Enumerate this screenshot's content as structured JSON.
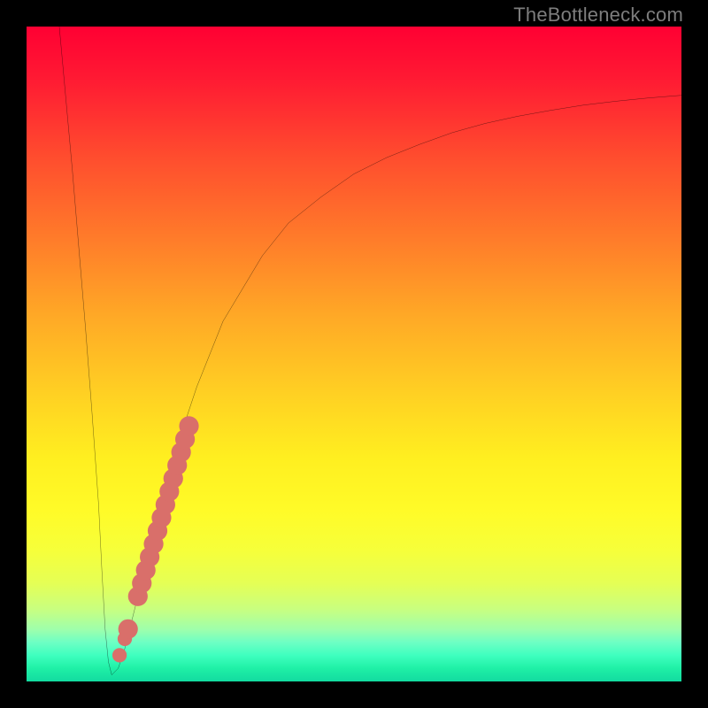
{
  "watermark": "TheBottleneck.com",
  "colors": {
    "frame": "#000000",
    "curve_stroke": "#000000",
    "dots_fill": "#d96f6a",
    "gradient_top": "#ff0033",
    "gradient_bottom": "#12dba0"
  },
  "chart_data": {
    "type": "line",
    "title": "",
    "xlabel": "",
    "ylabel": "",
    "xlim": [
      0,
      100
    ],
    "ylim": [
      0,
      100
    ],
    "series": [
      {
        "name": "bottleneck-curve",
        "x": [
          5,
          6,
          7,
          8,
          9,
          10,
          11,
          11.5,
          12,
          12.5,
          13,
          14,
          15,
          16,
          18,
          20,
          22,
          24,
          26,
          28,
          30,
          33,
          36,
          40,
          45,
          50,
          55,
          60,
          65,
          70,
          75,
          80,
          85,
          90,
          95,
          100
        ],
        "y": [
          100,
          89,
          78,
          66,
          54,
          41,
          27,
          17,
          8,
          3,
          1,
          2,
          5,
          9,
          17,
          25,
          32,
          39,
          45,
          50,
          55,
          60,
          65,
          70,
          74,
          77.5,
          80,
          82,
          83.8,
          85.2,
          86.3,
          87.2,
          88,
          88.6,
          89.1,
          89.5
        ]
      }
    ],
    "dots": [
      {
        "x": 14.2,
        "y": 4.0,
        "r": 1.1
      },
      {
        "x": 15.0,
        "y": 6.5,
        "r": 1.1
      },
      {
        "x": 15.5,
        "y": 8.0,
        "r": 1.5
      },
      {
        "x": 17.0,
        "y": 13.0,
        "r": 1.5
      },
      {
        "x": 17.6,
        "y": 15.0,
        "r": 1.5
      },
      {
        "x": 18.2,
        "y": 17.0,
        "r": 1.5
      },
      {
        "x": 18.8,
        "y": 19.0,
        "r": 1.5
      },
      {
        "x": 19.4,
        "y": 21.0,
        "r": 1.5
      },
      {
        "x": 20.0,
        "y": 23.0,
        "r": 1.5
      },
      {
        "x": 20.6,
        "y": 25.0,
        "r": 1.5
      },
      {
        "x": 21.2,
        "y": 27.0,
        "r": 1.5
      },
      {
        "x": 21.8,
        "y": 29.0,
        "r": 1.5
      },
      {
        "x": 22.4,
        "y": 31.0,
        "r": 1.5
      },
      {
        "x": 23.0,
        "y": 33.0,
        "r": 1.5
      },
      {
        "x": 23.6,
        "y": 35.0,
        "r": 1.5
      },
      {
        "x": 24.2,
        "y": 37.0,
        "r": 1.5
      },
      {
        "x": 24.8,
        "y": 39.0,
        "r": 1.5
      }
    ]
  }
}
